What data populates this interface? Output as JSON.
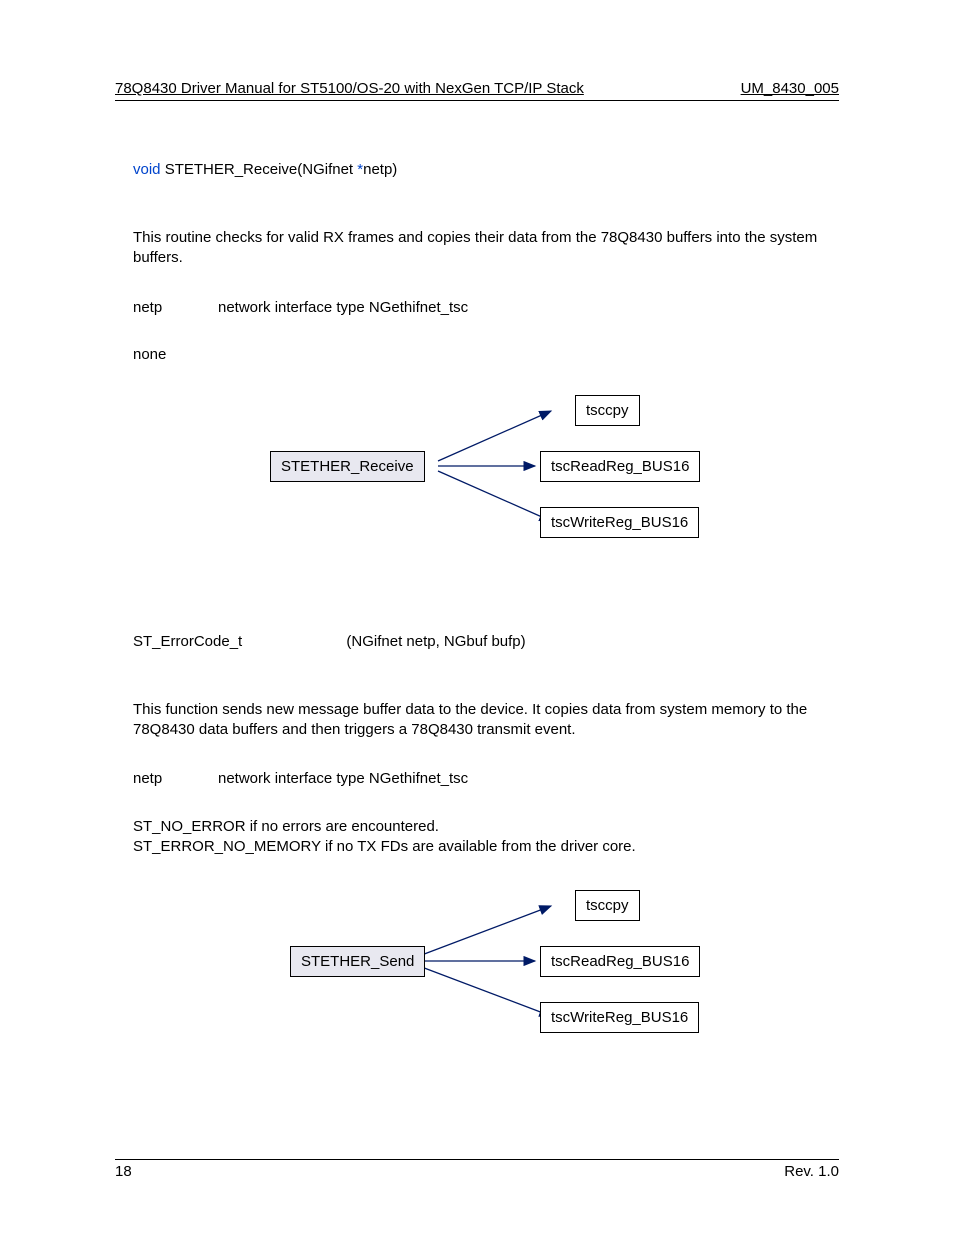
{
  "header": {
    "left": "78Q8430 Driver Manual for ST5100/OS-20 with NexGen TCP/IP Stack",
    "right": "UM_8430_005"
  },
  "section1": {
    "proto_kw1": "void",
    "proto_fn": " STETHER_Receive(NGifnet ",
    "proto_kw2": "*",
    "proto_tail": "netp)",
    "description": "This routine checks for valid RX frames and copies their data from the 78Q8430 buffers into the system buffers.",
    "param_name": "netp",
    "param_desc": "network interface type NGethifnet_tsc",
    "returns": "none",
    "diagram": {
      "main": "STETHER_Receive",
      "b1": "tsccpy",
      "b2": "tscReadReg_BUS16",
      "b3": "tscWriteReg_BUS16"
    }
  },
  "section2": {
    "proto_ret": "ST_ErrorCode_t ",
    "proto_args": "(NGifnet  netp, NGbuf  bufp)",
    "description": "This function sends new message buffer data to the device.  It copies data from system memory to the 78Q8430 data buffers and then triggers a 78Q8430 transmit event.",
    "param_name": "netp",
    "param_desc": "network interface type NGethifnet_tsc",
    "returns_line1": "ST_NO_ERROR if no errors are encountered.",
    "returns_line2": "ST_ERROR_NO_MEMORY if no TX FDs are available from the driver core.",
    "diagram": {
      "main": "STETHER_Send",
      "b1": "tsccpy",
      "b2": "tscReadReg_BUS16",
      "b3": "tscWriteReg_BUS16"
    }
  },
  "footer": {
    "page": "18",
    "rev": "Rev. 1.0"
  }
}
